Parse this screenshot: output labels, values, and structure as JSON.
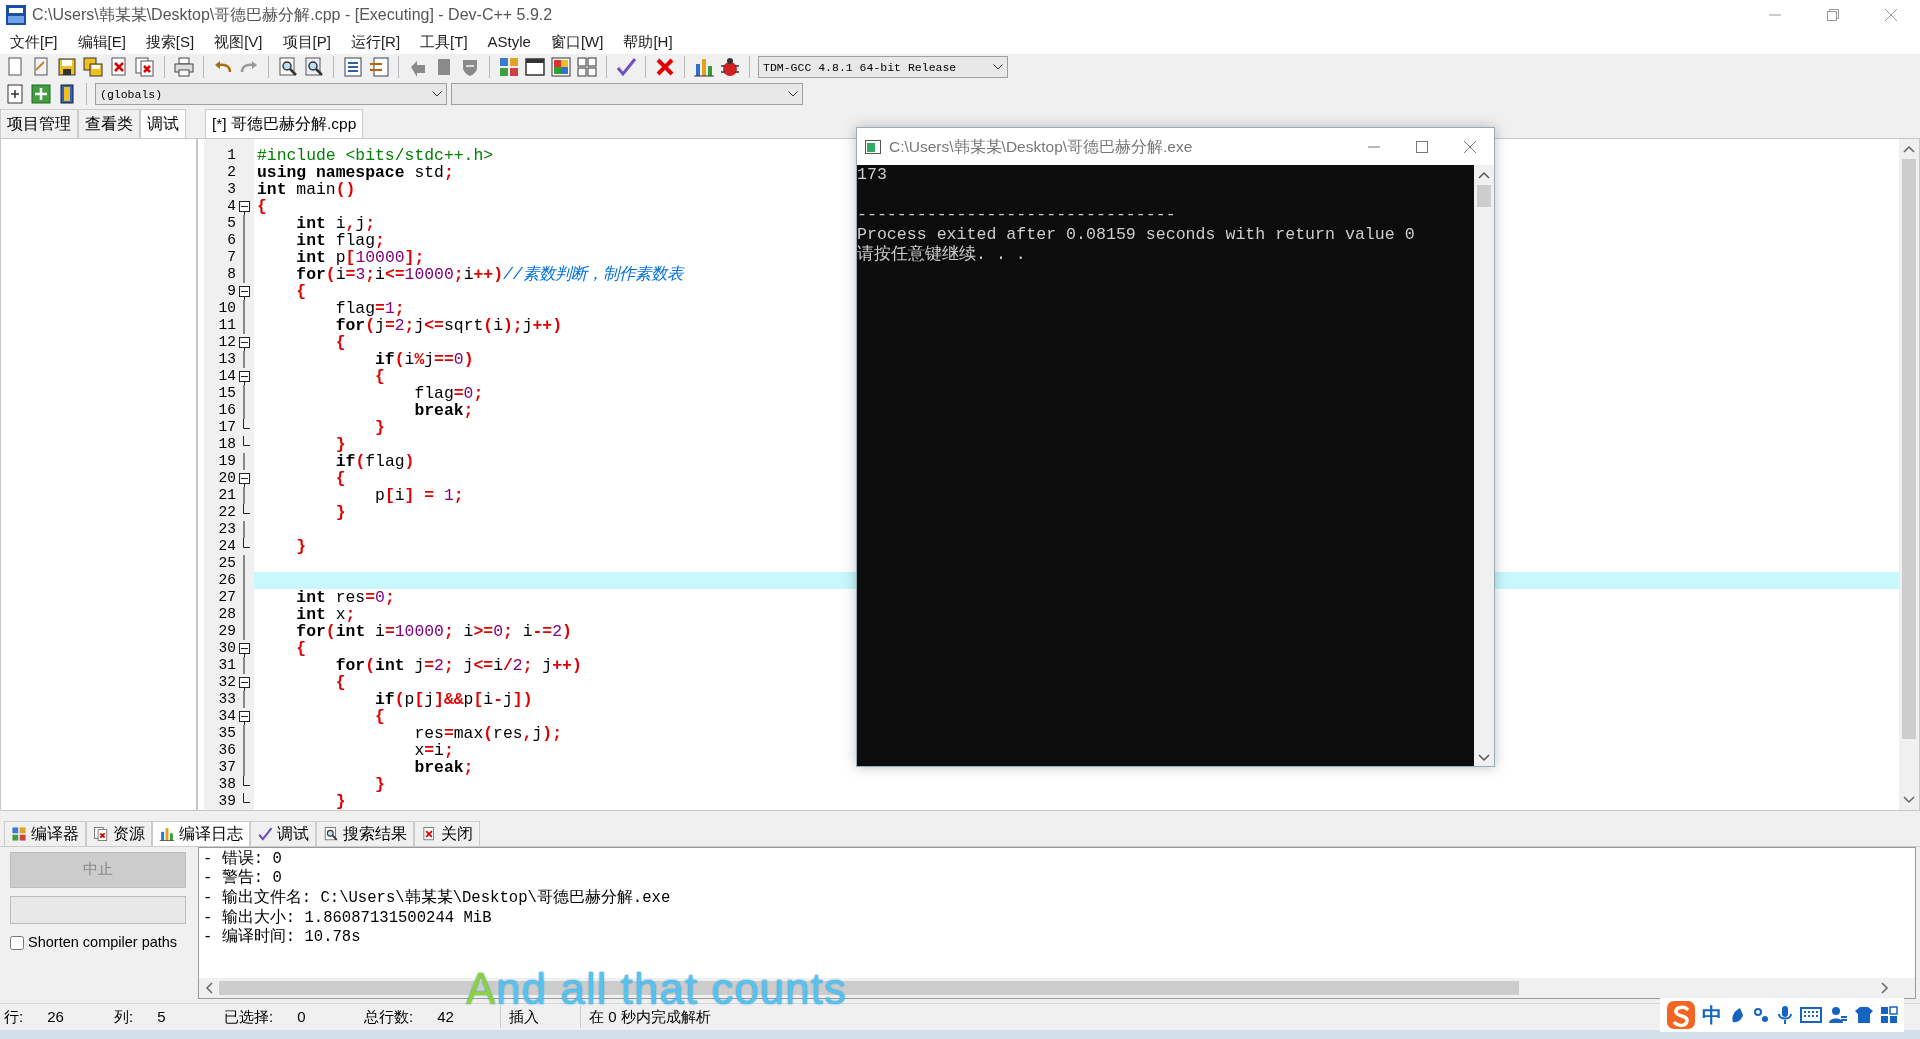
{
  "window": {
    "title": "C:\\Users\\韩某某\\Desktop\\哥德巴赫分解.cpp - [Executing] - Dev-C++ 5.9.2"
  },
  "menu": [
    "文件[F]",
    "编辑[E]",
    "搜索[S]",
    "视图[V]",
    "项目[P]",
    "运行[R]",
    "工具[T]",
    "AStyle",
    "窗口[W]",
    "帮助[H]"
  ],
  "toolbar": {
    "compiler": "TDM-GCC 4.8.1 64-bit Release",
    "scope": "(globals)"
  },
  "left_panel": {
    "tabs": [
      {
        "label": "项目管理",
        "selected": false
      },
      {
        "label": "查看类",
        "selected": false
      },
      {
        "label": "调试",
        "selected": true
      }
    ]
  },
  "editor": {
    "file_tab": "[*] 哥德巴赫分解.cpp",
    "lines": [
      {
        "number": "1",
        "current": false,
        "kind": "plain",
        "tokens": [
          {
            "kind": "pre",
            "text": "#include <bits/stdc++.h>"
          }
        ]
      },
      {
        "number": "2",
        "current": false,
        "kind": "plain",
        "tokens": [
          {
            "kind": "kw",
            "text": "using namespace"
          },
          {
            "kind": "id",
            "text": " std"
          },
          {
            "kind": "sym",
            "text": ";"
          }
        ]
      },
      {
        "number": "3",
        "current": false,
        "kind": "plain",
        "tokens": [
          {
            "kind": "kw",
            "text": "int"
          },
          {
            "kind": "id",
            "text": " main"
          },
          {
            "kind": "sym",
            "text": "()"
          }
        ]
      },
      {
        "number": "4",
        "current": false,
        "kind": "start",
        "tokens": [
          {
            "kind": "sym",
            "text": "{"
          }
        ]
      },
      {
        "number": "5",
        "current": false,
        "kind": "line",
        "tokens": [
          {
            "kind": "kw",
            "text": "    int"
          },
          {
            "kind": "id",
            "text": " i"
          },
          {
            "kind": "sym",
            "text": ","
          },
          {
            "kind": "id",
            "text": "j"
          },
          {
            "kind": "sym",
            "text": ";"
          }
        ]
      },
      {
        "number": "6",
        "current": false,
        "kind": "line",
        "tokens": [
          {
            "kind": "kw",
            "text": "    int"
          },
          {
            "kind": "id",
            "text": " flag"
          },
          {
            "kind": "sym",
            "text": ";"
          }
        ]
      },
      {
        "number": "7",
        "current": false,
        "kind": "line",
        "tokens": [
          {
            "kind": "kw",
            "text": "    int"
          },
          {
            "kind": "id",
            "text": " p"
          },
          {
            "kind": "sym",
            "text": "["
          },
          {
            "kind": "num",
            "text": "10000"
          },
          {
            "kind": "sym",
            "text": "];"
          }
        ]
      },
      {
        "number": "8",
        "current": false,
        "kind": "line",
        "tokens": [
          {
            "kind": "kw",
            "text": "    for"
          },
          {
            "kind": "sym",
            "text": "("
          },
          {
            "kind": "id",
            "text": "i"
          },
          {
            "kind": "sym",
            "text": "="
          },
          {
            "kind": "num",
            "text": "3"
          },
          {
            "kind": "sym",
            "text": ";"
          },
          {
            "kind": "id",
            "text": "i"
          },
          {
            "kind": "sym",
            "text": "<="
          },
          {
            "kind": "num",
            "text": "10000"
          },
          {
            "kind": "sym",
            "text": ";"
          },
          {
            "kind": "id",
            "text": "i"
          },
          {
            "kind": "sym",
            "text": "++)"
          },
          {
            "kind": "com",
            "text": "//素数判断，制作素数表"
          }
        ]
      },
      {
        "number": "9",
        "current": false,
        "kind": "start",
        "tokens": [
          {
            "kind": "sym",
            "text": "    {"
          }
        ]
      },
      {
        "number": "10",
        "current": false,
        "kind": "line",
        "tokens": [
          {
            "kind": "id",
            "text": "        flag"
          },
          {
            "kind": "sym",
            "text": "="
          },
          {
            "kind": "num",
            "text": "1"
          },
          {
            "kind": "sym",
            "text": ";"
          }
        ]
      },
      {
        "number": "11",
        "current": false,
        "kind": "line",
        "tokens": [
          {
            "kind": "kw",
            "text": "        for"
          },
          {
            "kind": "sym",
            "text": "("
          },
          {
            "kind": "id",
            "text": "j"
          },
          {
            "kind": "sym",
            "text": "="
          },
          {
            "kind": "num",
            "text": "2"
          },
          {
            "kind": "sym",
            "text": ";"
          },
          {
            "kind": "id",
            "text": "j"
          },
          {
            "kind": "sym",
            "text": "<="
          },
          {
            "kind": "id",
            "text": "sqrt"
          },
          {
            "kind": "sym",
            "text": "("
          },
          {
            "kind": "id",
            "text": "i"
          },
          {
            "kind": "sym",
            "text": ");"
          },
          {
            "kind": "id",
            "text": "j"
          },
          {
            "kind": "sym",
            "text": "++)"
          }
        ]
      },
      {
        "number": "12",
        "current": false,
        "kind": "start",
        "tokens": [
          {
            "kind": "sym",
            "text": "        {"
          }
        ]
      },
      {
        "number": "13",
        "current": false,
        "kind": "line",
        "tokens": [
          {
            "kind": "kw",
            "text": "            if"
          },
          {
            "kind": "sym",
            "text": "("
          },
          {
            "kind": "id",
            "text": "i"
          },
          {
            "kind": "sym",
            "text": "%"
          },
          {
            "kind": "id",
            "text": "j"
          },
          {
            "kind": "sym",
            "text": "=="
          },
          {
            "kind": "num",
            "text": "0"
          },
          {
            "kind": "sym",
            "text": ")"
          }
        ]
      },
      {
        "number": "14",
        "current": false,
        "kind": "start",
        "tokens": [
          {
            "kind": "sym",
            "text": "            {"
          }
        ]
      },
      {
        "number": "15",
        "current": false,
        "kind": "line",
        "tokens": [
          {
            "kind": "id",
            "text": "                flag"
          },
          {
            "kind": "sym",
            "text": "="
          },
          {
            "kind": "num",
            "text": "0"
          },
          {
            "kind": "sym",
            "text": ";"
          }
        ]
      },
      {
        "number": "16",
        "current": false,
        "kind": "line",
        "tokens": [
          {
            "kind": "kw",
            "text": "                break"
          },
          {
            "kind": "sym",
            "text": ";"
          }
        ]
      },
      {
        "number": "17",
        "current": false,
        "kind": "end",
        "tokens": [
          {
            "kind": "sym",
            "text": "            }"
          }
        ]
      },
      {
        "number": "18",
        "current": false,
        "kind": "end",
        "tokens": [
          {
            "kind": "sym",
            "text": "        }"
          }
        ]
      },
      {
        "number": "19",
        "current": false,
        "kind": "line",
        "tokens": [
          {
            "kind": "kw",
            "text": "        if"
          },
          {
            "kind": "sym",
            "text": "("
          },
          {
            "kind": "id",
            "text": "flag"
          },
          {
            "kind": "sym",
            "text": ")"
          }
        ]
      },
      {
        "number": "20",
        "current": false,
        "kind": "start",
        "tokens": [
          {
            "kind": "sym",
            "text": "        {"
          }
        ]
      },
      {
        "number": "21",
        "current": false,
        "kind": "line",
        "tokens": [
          {
            "kind": "id",
            "text": "            p"
          },
          {
            "kind": "sym",
            "text": "["
          },
          {
            "kind": "id",
            "text": "i"
          },
          {
            "kind": "sym",
            "text": "] ="
          },
          {
            "kind": "num",
            "text": " 1"
          },
          {
            "kind": "sym",
            "text": ";"
          }
        ]
      },
      {
        "number": "22",
        "current": false,
        "kind": "end",
        "tokens": [
          {
            "kind": "sym",
            "text": "        }"
          }
        ]
      },
      {
        "number": "23",
        "current": false,
        "kind": "line"
      },
      {
        "number": "24",
        "current": false,
        "kind": "end",
        "tokens": [
          {
            "kind": "sym",
            "text": "    }"
          }
        ]
      },
      {
        "number": "25",
        "current": false,
        "kind": "line"
      },
      {
        "number": "26",
        "current": true,
        "kind": "line"
      },
      {
        "number": "27",
        "current": false,
        "kind": "line",
        "tokens": [
          {
            "kind": "kw",
            "text": "    int"
          },
          {
            "kind": "id",
            "text": " res"
          },
          {
            "kind": "sym",
            "text": "="
          },
          {
            "kind": "num",
            "text": "0"
          },
          {
            "kind": "sym",
            "text": ";"
          }
        ]
      },
      {
        "number": "28",
        "current": false,
        "kind": "line",
        "tokens": [
          {
            "kind": "kw",
            "text": "    int"
          },
          {
            "kind": "id",
            "text": " x"
          },
          {
            "kind": "sym",
            "text": ";"
          }
        ]
      },
      {
        "number": "29",
        "current": false,
        "kind": "line",
        "tokens": [
          {
            "kind": "kw",
            "text": "    for"
          },
          {
            "kind": "sym",
            "text": "("
          },
          {
            "kind": "kw",
            "text": "int"
          },
          {
            "kind": "id",
            "text": " i"
          },
          {
            "kind": "sym",
            "text": "="
          },
          {
            "kind": "num",
            "text": "10000"
          },
          {
            "kind": "sym",
            "text": ";"
          },
          {
            "kind": "id",
            "text": " i"
          },
          {
            "kind": "sym",
            "text": ">="
          },
          {
            "kind": "num",
            "text": "0"
          },
          {
            "kind": "sym",
            "text": ";"
          },
          {
            "kind": "id",
            "text": " i"
          },
          {
            "kind": "sym",
            "text": "-="
          },
          {
            "kind": "num",
            "text": "2"
          },
          {
            "kind": "sym",
            "text": ")"
          }
        ]
      },
      {
        "number": "30",
        "current": false,
        "kind": "start",
        "tokens": [
          {
            "kind": "sym",
            "text": "    {"
          }
        ]
      },
      {
        "number": "31",
        "current": false,
        "kind": "line",
        "tokens": [
          {
            "kind": "kw",
            "text": "        for"
          },
          {
            "kind": "sym",
            "text": "("
          },
          {
            "kind": "kw",
            "text": "int"
          },
          {
            "kind": "id",
            "text": " j"
          },
          {
            "kind": "sym",
            "text": "="
          },
          {
            "kind": "num",
            "text": "2"
          },
          {
            "kind": "sym",
            "text": ";"
          },
          {
            "kind": "id",
            "text": " j"
          },
          {
            "kind": "sym",
            "text": "<="
          },
          {
            "kind": "id",
            "text": "i"
          },
          {
            "kind": "sym",
            "text": "/"
          },
          {
            "kind": "num",
            "text": "2"
          },
          {
            "kind": "sym",
            "text": ";"
          },
          {
            "kind": "id",
            "text": " j"
          },
          {
            "kind": "sym",
            "text": "++)"
          }
        ]
      },
      {
        "number": "32",
        "current": false,
        "kind": "start",
        "tokens": [
          {
            "kind": "sym",
            "text": "        {"
          }
        ]
      },
      {
        "number": "33",
        "current": false,
        "kind": "line",
        "tokens": [
          {
            "kind": "kw",
            "text": "            if"
          },
          {
            "kind": "sym",
            "text": "("
          },
          {
            "kind": "id",
            "text": "p"
          },
          {
            "kind": "sym",
            "text": "["
          },
          {
            "kind": "id",
            "text": "j"
          },
          {
            "kind": "sym",
            "text": "]&&"
          },
          {
            "kind": "id",
            "text": "p"
          },
          {
            "kind": "sym",
            "text": "["
          },
          {
            "kind": "id",
            "text": "i"
          },
          {
            "kind": "sym",
            "text": "-"
          },
          {
            "kind": "id",
            "text": "j"
          },
          {
            "kind": "sym",
            "text": "])"
          }
        ]
      },
      {
        "number": "34",
        "current": false,
        "kind": "start",
        "tokens": [
          {
            "kind": "sym",
            "text": "            {"
          }
        ]
      },
      {
        "number": "35",
        "current": false,
        "kind": "line",
        "tokens": [
          {
            "kind": "id",
            "text": "                res"
          },
          {
            "kind": "sym",
            "text": "="
          },
          {
            "kind": "id",
            "text": "max"
          },
          {
            "kind": "sym",
            "text": "("
          },
          {
            "kind": "id",
            "text": "res"
          },
          {
            "kind": "sym",
            "text": ","
          },
          {
            "kind": "id",
            "text": "j"
          },
          {
            "kind": "sym",
            "text": ");"
          }
        ]
      },
      {
        "number": "36",
        "current": false,
        "kind": "line",
        "tokens": [
          {
            "kind": "id",
            "text": "                x"
          },
          {
            "kind": "sym",
            "text": "="
          },
          {
            "kind": "id",
            "text": "i"
          },
          {
            "kind": "sym",
            "text": ";"
          }
        ]
      },
      {
        "number": "37",
        "current": false,
        "kind": "line",
        "tokens": [
          {
            "kind": "kw",
            "text": "                break"
          },
          {
            "kind": "sym",
            "text": ";"
          }
        ]
      },
      {
        "number": "38",
        "current": false,
        "kind": "end",
        "tokens": [
          {
            "kind": "sym",
            "text": "            }"
          }
        ]
      },
      {
        "number": "39",
        "current": false,
        "kind": "end",
        "tokens": [
          {
            "kind": "sym",
            "text": "        }"
          }
        ]
      }
    ]
  },
  "console": {
    "title": "C:\\Users\\韩某某\\Desktop\\哥德巴赫分解.exe",
    "output": [
      "173"
    ],
    "footer": [
      "--------------------------------",
      "Process exited after 0.08159 seconds with return value 0",
      "请按任意键继续. . ."
    ]
  },
  "bottom_panel": {
    "tabs": [
      {
        "label": "编译器",
        "selected": false
      },
      {
        "label": "资源",
        "selected": false
      },
      {
        "label": "编译日志",
        "selected": true
      },
      {
        "label": "调试",
        "selected": false
      },
      {
        "label": "搜索结果",
        "selected": false
      },
      {
        "label": "关闭",
        "selected": false
      }
    ],
    "abort_button": {
      "label": "中止",
      "disabled": true
    },
    "progress": {
      "level": 0
    },
    "checkbox": {
      "label": "Shorten compiler paths",
      "checked": false
    },
    "log": [
      "- 错误: 0",
      "- 警告: 0",
      "- 输出文件名: C:\\Users\\韩某某\\Desktop\\哥德巴赫分解.exe",
      "- 输出大小: 1.86087131500244 MiB",
      "- 编译时间: 10.78s"
    ]
  },
  "status_bar": {
    "fields": [
      {
        "label": "行:",
        "value": "26"
      },
      {
        "label": "列:",
        "value": "5"
      },
      {
        "label": "已选择:",
        "value": "0"
      },
      {
        "label": "总行数:",
        "value": "42"
      }
    ],
    "mode": "插入",
    "message": "在 0 秒内完成解析"
  },
  "ime": {
    "label": "中"
  },
  "lyric": "And all that counts"
}
